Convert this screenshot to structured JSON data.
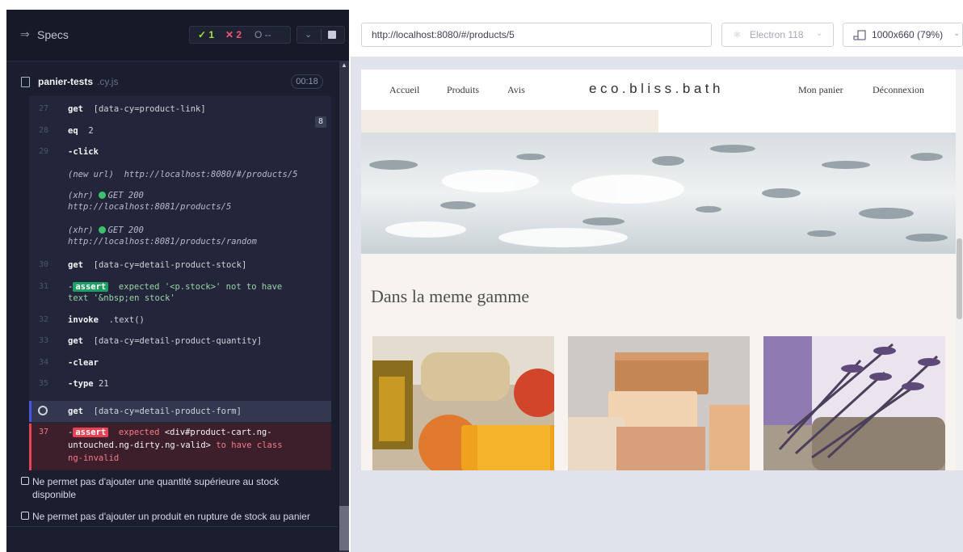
{
  "runner": {
    "specs_label": "Specs",
    "stats": {
      "passed": "✓ 1",
      "failed": "✕ 2",
      "pending": "O --"
    },
    "file": {
      "name": "panier-tests",
      "ext": ".cy.js",
      "duration": "00:18"
    },
    "commands": [
      {
        "num": "27",
        "name": "get",
        "arg": "[data-cy=product-link]",
        "count": "8"
      },
      {
        "num": "28",
        "name": "eq",
        "arg": "2"
      },
      {
        "num": "29",
        "name": "-click",
        "arg": ""
      },
      {
        "label": "(new url)",
        "url": "http://localhost:8080/#/products/5"
      },
      {
        "label": "(xhr)",
        "status": "GET 200",
        "url": "http://localhost:8081/products/5"
      },
      {
        "label": "(xhr)",
        "status": "GET 200",
        "url": "http://localhost:8081/products/random"
      },
      {
        "num": "30",
        "name": "get",
        "arg": "[data-cy=detail-product-stock]"
      },
      {
        "num": "31",
        "badge": "assert",
        "line1": "expected '<p.stock>' not to have",
        "line2": "text '&nbsp;en stock'"
      },
      {
        "num": "32",
        "name": "invoke",
        "arg": ".text()"
      },
      {
        "num": "33",
        "name": "get",
        "arg": "[data-cy=detail-product-quantity]"
      },
      {
        "num": "34",
        "name": "-clear",
        "arg": ""
      },
      {
        "num": "35",
        "name": "-type",
        "arg": "21"
      },
      {
        "name": "get",
        "arg": "[data-cy=detail-product-form]"
      },
      {
        "num": "37",
        "badge": "assert",
        "pre": "expected",
        "subject": "<div#product-cart.ng-",
        "line2a": "untouched.ng-dirty.ng-valid>",
        "line2b": "to have class",
        "line3": "ng-invalid"
      }
    ],
    "tests": [
      {
        "line1": "Ne permet pas d'ajouter une quantité supérieure au stock",
        "line2": "disponible"
      },
      {
        "line1": "Ne permet pas d'ajouter un produit en rupture de stock au panier"
      }
    ]
  },
  "browser": {
    "url": "http://localhost:8080/#/products/5",
    "name": "Electron 118",
    "viewport": "1000x660 (79%)"
  },
  "site": {
    "nav": {
      "home": "Accueil",
      "products": "Produits",
      "reviews": "Avis",
      "cart": "Mon panier",
      "logout": "Déconnexion"
    },
    "logo": "eco.bliss.bath",
    "section_title": "Dans la meme gamme"
  },
  "colors": {
    "pass": "#a3e635",
    "fail": "#f05975",
    "accent": "#4956e3",
    "runner_bg": "#1b1e2e"
  }
}
